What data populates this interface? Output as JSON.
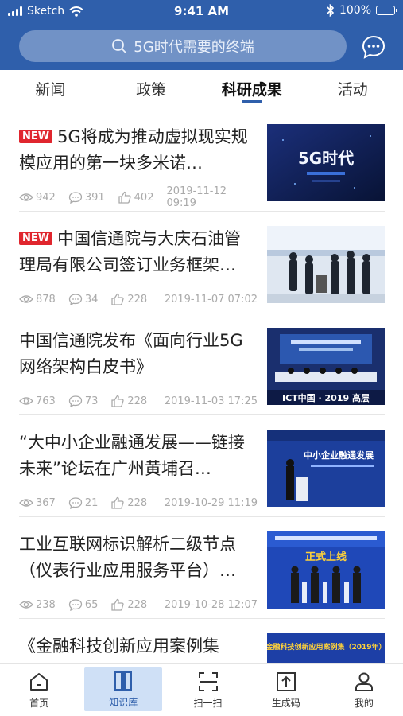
{
  "status_bar": {
    "carrier": "Sketch",
    "time": "9:41 AM",
    "battery": "100%"
  },
  "header": {
    "search_placeholder": "5G时代需要的终端"
  },
  "tabs": [
    {
      "label": "新闻",
      "active": false
    },
    {
      "label": "政策",
      "active": false
    },
    {
      "label": "科研成果",
      "active": true
    },
    {
      "label": "活动",
      "active": false
    }
  ],
  "articles": [
    {
      "badge": "NEW",
      "title": "5G将成为推动虚拟现实规模应用的第一块多米诺…",
      "views": "942",
      "comments": "391",
      "likes": "402",
      "date": "2019-11-12 09:19",
      "thumb_text": "5G时代"
    },
    {
      "badge": "NEW",
      "title": "中国信通院与大庆石油管理局有限公司签订业务框架…",
      "views": "878",
      "comments": "34",
      "likes": "228",
      "date": "2019-11-07 07:02",
      "thumb_text": ""
    },
    {
      "badge": "",
      "title": "中国信通院发布《面向行业5G网络架构白皮书》",
      "views": "763",
      "comments": "73",
      "likes": "228",
      "date": "2019-11-03 17:25",
      "thumb_text": "ICT中国 · 2019 高层"
    },
    {
      "badge": "",
      "title": "“大中小企业融通发展——链接未来”论坛在广州黄埔召…",
      "views": "367",
      "comments": "21",
      "likes": "228",
      "date": "2019-10-29 11:19",
      "thumb_text": "中小企业融通发展"
    },
    {
      "badge": "",
      "title": "工业互联网标识解析二级节点（仪表行业应用服务平台）…",
      "views": "238",
      "comments": "65",
      "likes": "228",
      "date": "2019-10-28 12:07",
      "thumb_text": "正式上线"
    },
    {
      "badge": "",
      "title": "《金融科技创新应用案例集",
      "views": "",
      "comments": "",
      "likes": "",
      "date": "",
      "thumb_text": "金融科技创新应用案例集（2019年）"
    }
  ],
  "bottom_nav": [
    {
      "label": "首页",
      "icon": "home-icon",
      "active": false
    },
    {
      "label": "知识库",
      "icon": "book-icon",
      "active": true
    },
    {
      "label": "扫一扫",
      "icon": "scan-icon",
      "active": false
    },
    {
      "label": "生成码",
      "icon": "qr-generate-icon",
      "active": false
    },
    {
      "label": "我的",
      "icon": "user-icon",
      "active": false
    }
  ],
  "colors": {
    "header_bg": "#2f5fab",
    "badge": "#e0262e",
    "nav_active_bg": "#cfe0f6"
  }
}
